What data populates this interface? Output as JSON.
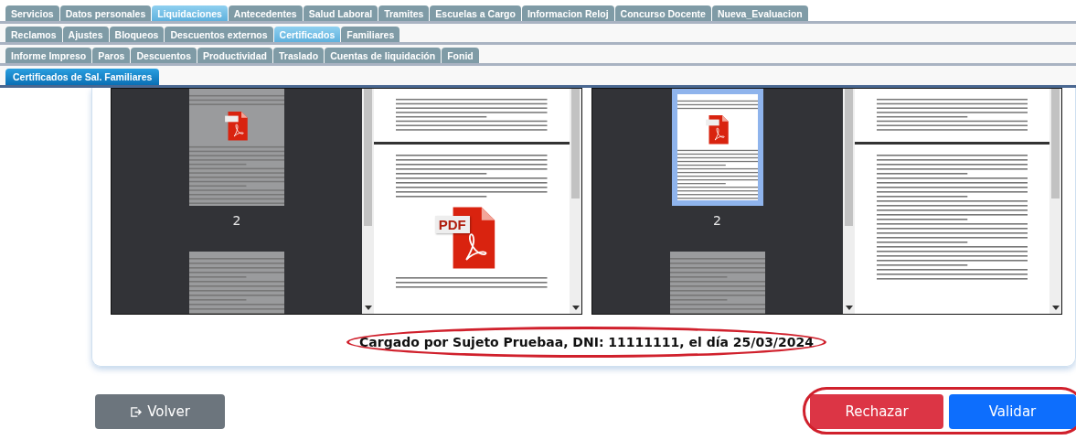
{
  "tab_rows": [
    [
      {
        "label": "Servicios",
        "selected": false
      },
      {
        "label": "Datos personales",
        "selected": false
      },
      {
        "label": "Liquidaciones",
        "selected": true
      },
      {
        "label": "Antecedentes",
        "selected": false
      },
      {
        "label": "Salud Laboral",
        "selected": false
      },
      {
        "label": "Tramites",
        "selected": false
      },
      {
        "label": "Escuelas a Cargo",
        "selected": false
      },
      {
        "label": "Informacion Reloj",
        "selected": false
      },
      {
        "label": "Concurso Docente",
        "selected": false
      },
      {
        "label": "Nueva_Evaluacion",
        "selected": false
      }
    ],
    [
      {
        "label": "Reclamos",
        "selected": false
      },
      {
        "label": "Ajustes",
        "selected": false
      },
      {
        "label": "Bloqueos",
        "selected": false
      },
      {
        "label": "Descuentos externos",
        "selected": false
      },
      {
        "label": "Certificados",
        "selected": true
      },
      {
        "label": "Familiares",
        "selected": false
      }
    ],
    [
      {
        "label": "Informe Impreso",
        "selected": false
      },
      {
        "label": "Paros",
        "selected": false
      },
      {
        "label": "Descuentos",
        "selected": false
      },
      {
        "label": "Productividad",
        "selected": false
      },
      {
        "label": "Traslado",
        "selected": false
      },
      {
        "label": "Cuentas de liquidación",
        "selected": false
      },
      {
        "label": "Fonid",
        "selected": false
      }
    ]
  ],
  "sub_tabs": [
    {
      "label": "Certificados de Sal. Familiares",
      "selected": true
    }
  ],
  "viewers": [
    {
      "thumbnails": [
        {
          "label": "2",
          "selected": false
        },
        {
          "selected": false
        }
      ],
      "pages": [
        {
          "kind": "text"
        },
        {
          "kind": "pdf",
          "icon_text": "PDF"
        }
      ]
    },
    {
      "thumbnails": [
        {
          "label": "2",
          "selected": true
        },
        {
          "selected": false
        }
      ],
      "pages": [
        {
          "kind": "text"
        },
        {
          "kind": "text"
        }
      ]
    }
  ],
  "caption": "Cargado por Sujeto Pruebaa, DNI: 11111111, el día 25/03/2024",
  "buttons": [
    {
      "kind": "back",
      "label": "Volver"
    },
    {
      "kind": "reject",
      "label": "Rechazar"
    },
    {
      "kind": "validate",
      "label": "Validar"
    }
  ]
}
